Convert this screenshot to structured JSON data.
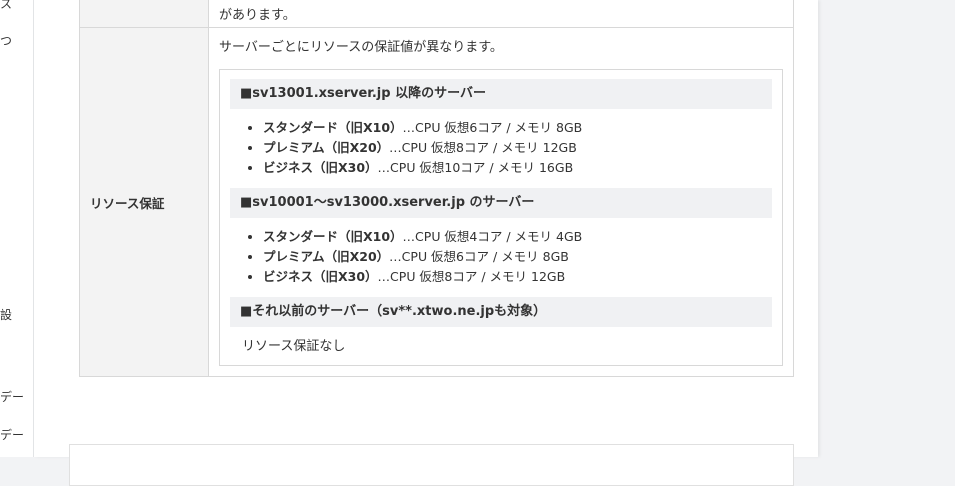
{
  "left_nav": {
    "fragments": [
      "ス",
      "つ",
      "設",
      "デー",
      "デー"
    ]
  },
  "table": {
    "top_row_text": "があります。",
    "resource": {
      "header": "リソース保証",
      "intro": "サーバーごとにリソースの保証値が異なります。",
      "groups": [
        {
          "title": "■sv13001.xserver.jp 以降のサーバー",
          "items": [
            {
              "plan": "スタンダード（旧X10）",
              "spec": "…CPU 仮想6コア / メモリ 8GB"
            },
            {
              "plan": "プレミアム（旧X20）",
              "spec": "…CPU 仮想8コア / メモリ 12GB"
            },
            {
              "plan": "ビジネス（旧X30）",
              "spec": "…CPU 仮想10コア / メモリ 16GB"
            }
          ]
        },
        {
          "title": "■sv10001～sv13000.xserver.jp のサーバー",
          "items": [
            {
              "plan": "スタンダード（旧X10）",
              "spec": "…CPU 仮想4コア / メモリ 4GB"
            },
            {
              "plan": "プレミアム（旧X20）",
              "spec": "…CPU 仮想6コア / メモリ 8GB"
            },
            {
              "plan": "ビジネス（旧X30）",
              "spec": "…CPU 仮想8コア / メモリ 12GB"
            }
          ]
        },
        {
          "title": "■それ以前のサーバー（sv**.xtwo.ne.jpも対象）",
          "note": "リソース保証なし"
        }
      ]
    }
  }
}
